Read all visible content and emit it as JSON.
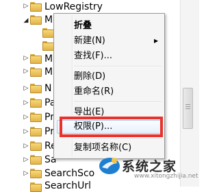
{
  "tree": {
    "nodes": [
      {
        "label": "LowRegistry"
      },
      {
        "label": "Mi"
      },
      {
        "label": ""
      },
      {
        "label": ""
      },
      {
        "label": "M"
      },
      {
        "label": "M"
      },
      {
        "label": "N"
      },
      {
        "label": "Pa"
      },
      {
        "label": "Pr"
      },
      {
        "label": "Pr"
      },
      {
        "label": "Re"
      },
      {
        "label": "Sa"
      },
      {
        "label": "SearchSco"
      },
      {
        "label": "SearchUrl"
      }
    ]
  },
  "menu": {
    "collapse": "折叠",
    "new": "新建(N)",
    "find": "查找(F)...",
    "delete": "删除(D)",
    "rename": "重命名(R)",
    "export": "导出(E)",
    "permissions": "权限(P)...",
    "copy_key_name": "复制项名称(C)"
  },
  "watermark": {
    "text": "系统之家",
    "url": "www.xitongzhijia.net"
  },
  "colors": {
    "highlight": "#e8322b",
    "folder": "#f2c85c"
  }
}
